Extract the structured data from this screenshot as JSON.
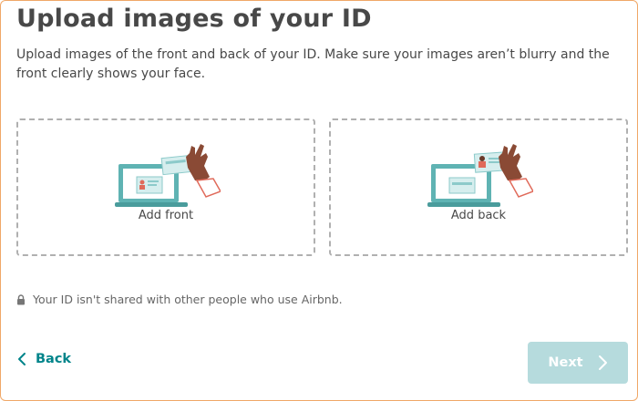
{
  "page": {
    "title": "Upload images of your ID",
    "description": "Upload images of the front and back of your ID. Make sure your images aren’t blurry and the front clearly shows your face."
  },
  "uploads": {
    "front_label": "Add front",
    "back_label": "Add back",
    "front_icon": "id-front-illustration-icon",
    "back_icon": "id-back-illustration-icon"
  },
  "privacy": {
    "text": "Your ID isn't shared with other people who use Airbnb.",
    "icon": "lock-icon"
  },
  "navigation": {
    "back_label": "Back",
    "next_label": "Next",
    "back_icon": "chevron-left-icon",
    "next_icon": "chevron-right-icon"
  },
  "colors": {
    "accent": "#00848a",
    "next_disabled_bg": "#b6dbdd",
    "dashed_border": "#b0b0b0",
    "text": "#484848",
    "frame_border": "#f0a868"
  }
}
